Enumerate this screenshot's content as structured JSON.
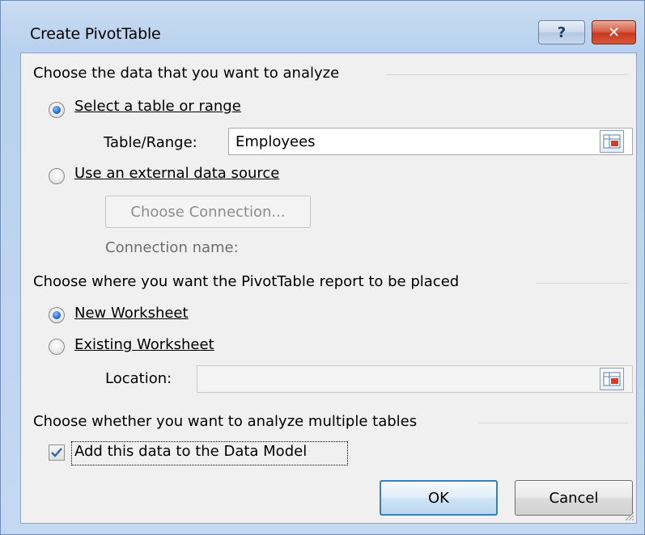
{
  "window": {
    "title": "Create PivotTable",
    "help_glyph": "?",
    "close_glyph": "✕"
  },
  "section_data": {
    "heading": "Choose the data that you want to analyze",
    "select_table_label": "Select a table or range",
    "select_table_checked": true,
    "table_range_label": "Table/Range:",
    "table_range_value": "Employees",
    "external_label": "Use an external data source",
    "external_checked": false,
    "choose_connection_label": "Choose Connection...",
    "connection_name_label": "Connection name:"
  },
  "section_location": {
    "heading": "Choose where you want the PivotTable report to be placed",
    "new_worksheet_label": "New Worksheet",
    "new_worksheet_checked": true,
    "existing_worksheet_label": "Existing Worksheet",
    "existing_worksheet_checked": false,
    "location_label": "Location:",
    "location_value": ""
  },
  "section_model": {
    "heading": "Choose whether you want to analyze multiple tables",
    "add_data_model_label": "Add this data to the Data Model",
    "add_data_model_checked": true
  },
  "buttons": {
    "ok_label": "OK",
    "cancel_label": "Cancel"
  },
  "icons": {
    "help": "help-icon",
    "close": "close-icon",
    "range_picker": "range-selector-icon",
    "checkmark": "checkmark-icon",
    "resize": "resize-grip-icon"
  },
  "colors": {
    "title_bar": "#b9d1ee",
    "close_button": "#c7381f",
    "default_button_border": "#3c7fb1",
    "radio_selected": "#2b6fd1"
  }
}
